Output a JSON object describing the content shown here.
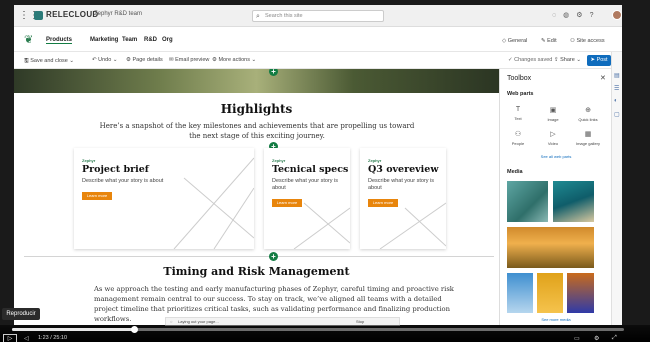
{
  "colors": {
    "accent_green": "#137c43",
    "primary_blue": "#0f6cbd",
    "button_orange": "#e8850c",
    "brand_teal": "#2b7a78"
  },
  "suitebar": {
    "brand": "RELECLOUD",
    "site": "Zephyr R&D team",
    "search_placeholder": "Search this site",
    "icons": [
      "chat-icon",
      "megaphone-icon",
      "gear-icon",
      "help-icon"
    ]
  },
  "nav": {
    "items": [
      "Products",
      "Marketing",
      "Team",
      "R&D",
      "Org"
    ],
    "right": [
      "General",
      "Edit",
      "Site access"
    ]
  },
  "commands": {
    "save_close": "Save and close",
    "undo": "Undo",
    "page_details": "Page details",
    "email_preview": "Email preview",
    "more_actions": "More actions",
    "changes_saved": "Changes saved",
    "share": "Share",
    "post": "Post"
  },
  "page": {
    "highlights_title": "Highlights",
    "highlights_text": "Here’s a snapshot of the key milestones and achievements that are propelling us toward the next stage of this exciting journey.",
    "cards": [
      {
        "eyebrow": "Zephyr",
        "title": "Project brief",
        "desc": "Describe what your story is about",
        "button": "Learn more"
      },
      {
        "eyebrow": "Zephyr",
        "title": "Tecnical specs",
        "desc": "Describe what your story is about",
        "button": "Learn more"
      },
      {
        "eyebrow": "Zephyr",
        "title": "Q3 overeview",
        "desc": "Describe what your story is about",
        "button": "Learn more"
      }
    ],
    "timing_title": "Timing and Risk Management",
    "timing_text": "As we approach the testing and early manufacturing phases of Zephyr, careful timing and proactive risk management remain central to our success. To stay on track, we’ve aligned all teams with a detailed project timeline that prioritizes critical tasks, such as validating performance and finalizing production workflows."
  },
  "toolbox": {
    "title": "Toolbox",
    "web_parts_label": "Web parts",
    "web_parts": [
      {
        "label": "Text",
        "icon": "text-icon"
      },
      {
        "label": "Image",
        "icon": "image-icon"
      },
      {
        "label": "Quick links",
        "icon": "globe-icon"
      },
      {
        "label": "People",
        "icon": "people-icon"
      },
      {
        "label": "Video",
        "icon": "video-icon"
      },
      {
        "label": "Image gallery",
        "icon": "gallery-icon"
      }
    ],
    "see_all_web_parts": "See all web parts",
    "media_label": "Media",
    "see_more_media": "See more media"
  },
  "toast": {
    "text": "Laying out your page...",
    "stop": "Stop"
  },
  "player": {
    "tooltip": "Reproducir",
    "time": "1:23 / 25:10",
    "progress": 0.2
  }
}
